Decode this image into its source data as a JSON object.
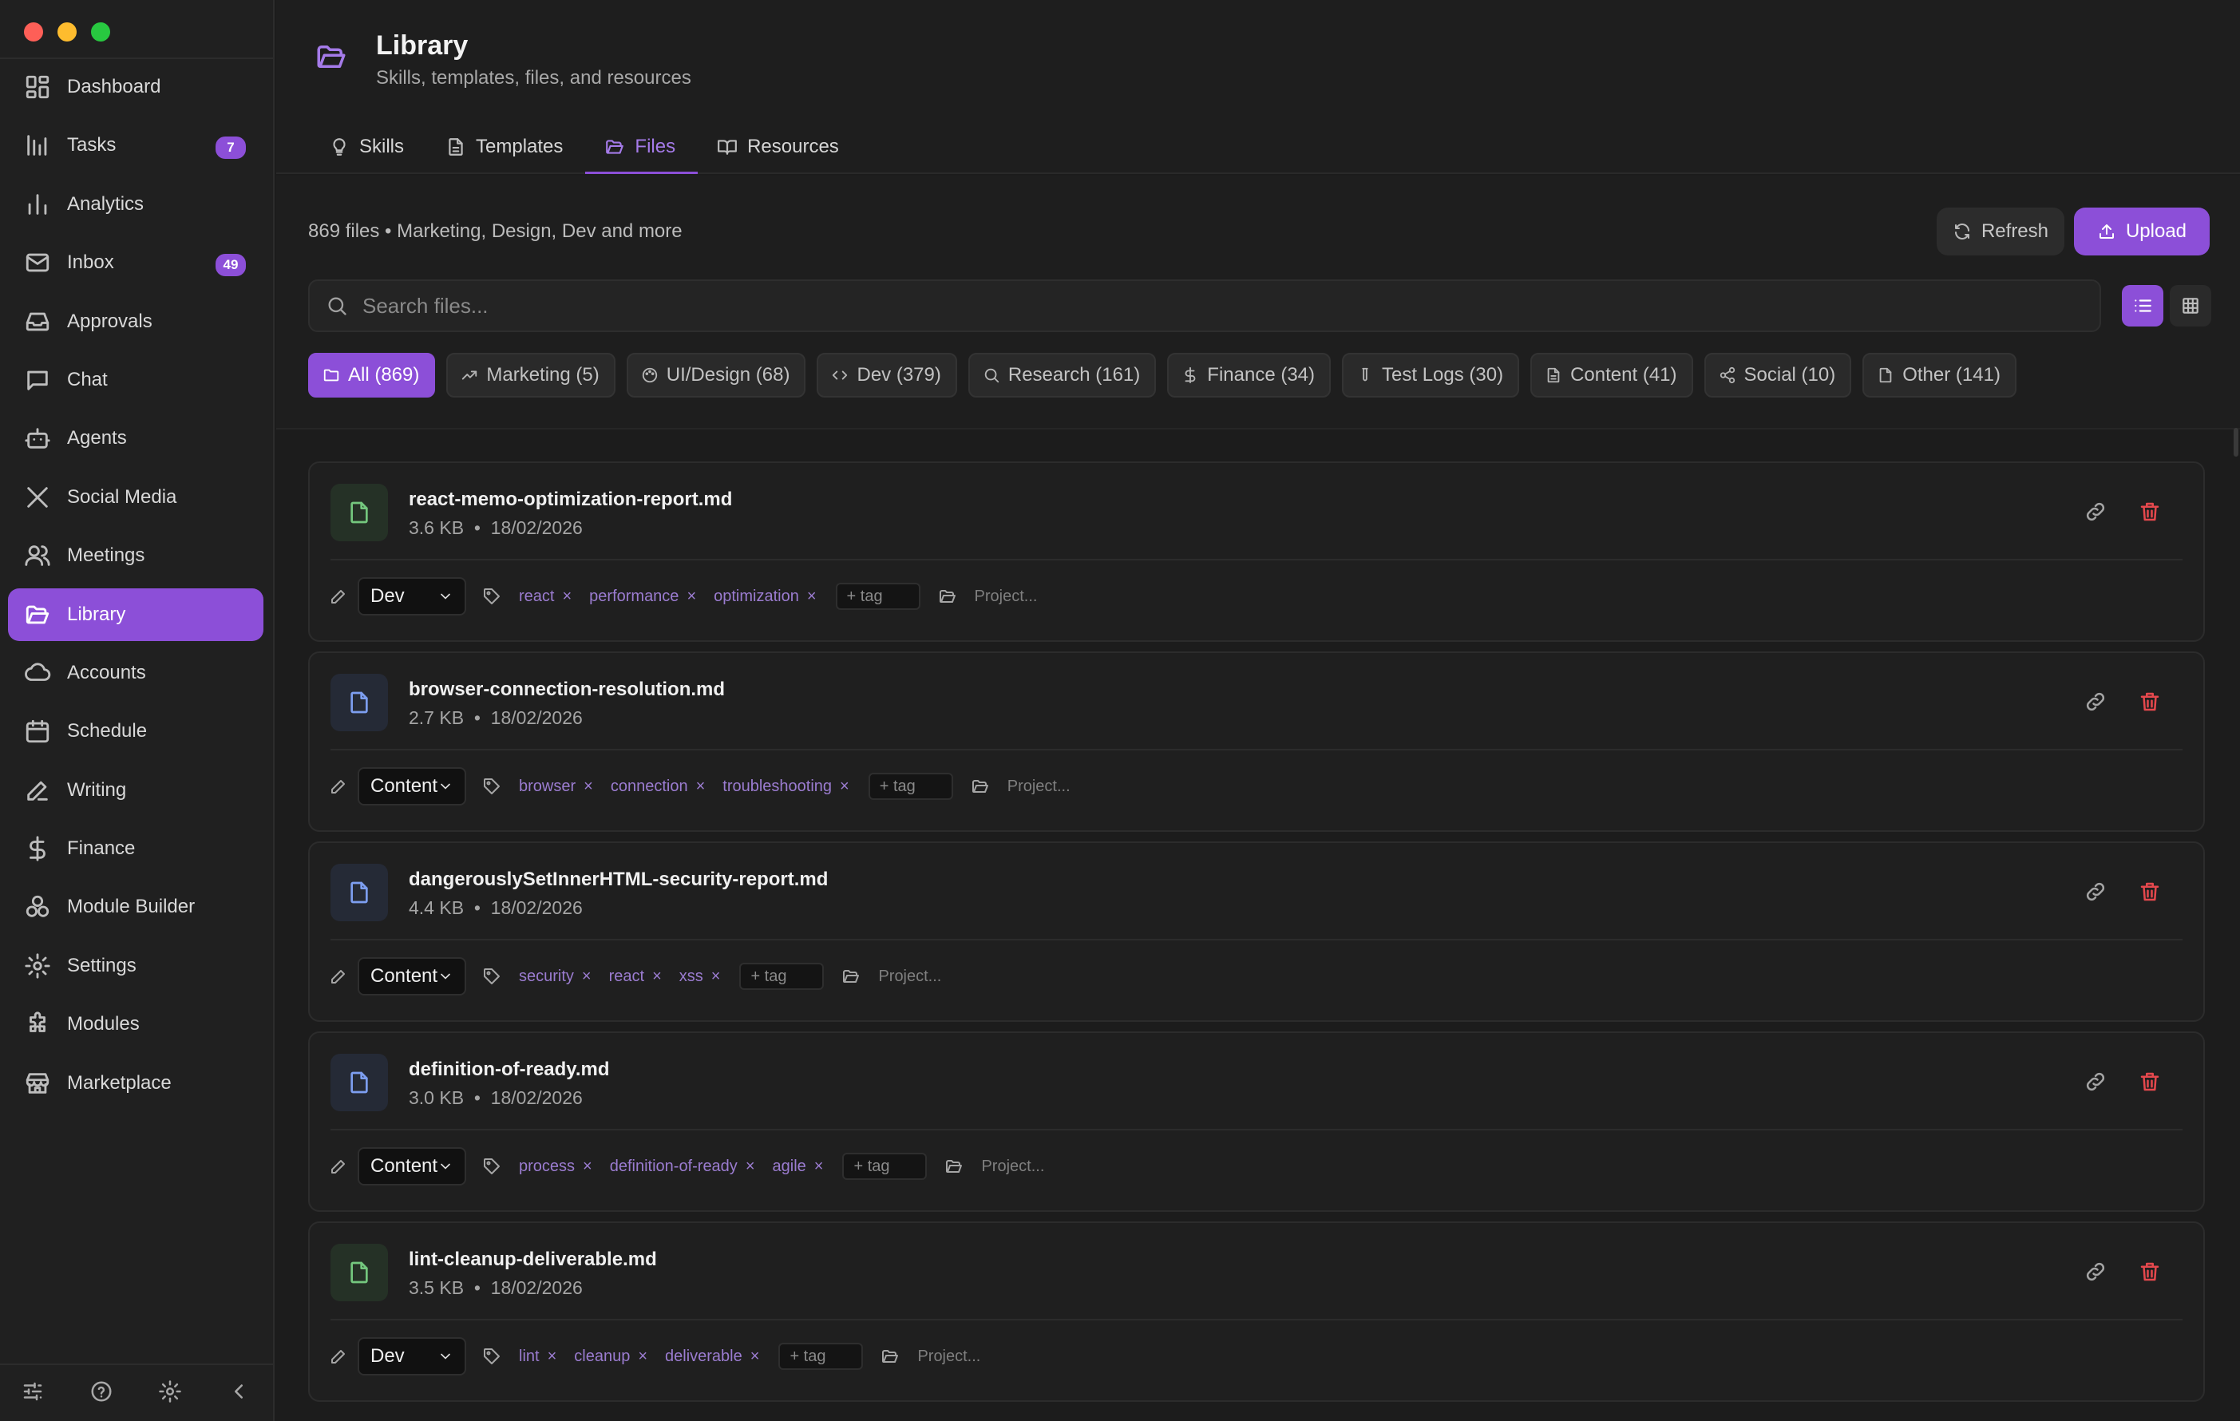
{
  "sidebar": {
    "items": [
      {
        "label": "Dashboard",
        "icon": "dashboard-icon",
        "badge": ""
      },
      {
        "label": "Tasks",
        "icon": "tasks-icon",
        "badge": "7"
      },
      {
        "label": "Analytics",
        "icon": "analytics-icon",
        "badge": ""
      },
      {
        "label": "Inbox",
        "icon": "inbox-icon",
        "badge": "49"
      },
      {
        "label": "Approvals",
        "icon": "approvals-icon",
        "badge": ""
      },
      {
        "label": "Chat",
        "icon": "chat-icon",
        "badge": ""
      },
      {
        "label": "Agents",
        "icon": "agents-icon",
        "badge": ""
      },
      {
        "label": "Social Media",
        "icon": "x-icon",
        "badge": ""
      },
      {
        "label": "Meetings",
        "icon": "meetings-icon",
        "badge": ""
      },
      {
        "label": "Library",
        "icon": "folder-open-icon",
        "badge": "",
        "active": true
      },
      {
        "label": "Accounts",
        "icon": "cloud-icon",
        "badge": ""
      },
      {
        "label": "Schedule",
        "icon": "calendar-icon",
        "badge": ""
      },
      {
        "label": "Writing",
        "icon": "pen-icon",
        "badge": ""
      },
      {
        "label": "Finance",
        "icon": "dollar-icon",
        "badge": ""
      },
      {
        "label": "Module Builder",
        "icon": "module-builder-icon",
        "badge": ""
      },
      {
        "label": "Settings",
        "icon": "settings-icon",
        "badge": ""
      },
      {
        "label": "Modules",
        "icon": "puzzle-icon",
        "badge": ""
      },
      {
        "label": "Marketplace",
        "icon": "store-icon",
        "badge": ""
      }
    ]
  },
  "header": {
    "title": "Library",
    "subtitle": "Skills, templates, files, and resources",
    "tabs": [
      {
        "label": "Skills",
        "icon": "lightbulb-icon"
      },
      {
        "label": "Templates",
        "icon": "document-icon"
      },
      {
        "label": "Files",
        "icon": "folder-open-icon",
        "active": true
      },
      {
        "label": "Resources",
        "icon": "book-icon"
      }
    ]
  },
  "toolbar": {
    "count_text": "869 files • Marketing, Design, Dev and more",
    "refresh_label": "Refresh",
    "upload_label": "Upload",
    "search_placeholder": "Search files..."
  },
  "filters": [
    {
      "label": "All (869)",
      "icon": "folder-icon",
      "active": true
    },
    {
      "label": "Marketing (5)",
      "icon": "trending-up-icon"
    },
    {
      "label": "UI/Design (68)",
      "icon": "palette-icon"
    },
    {
      "label": "Dev (379)",
      "icon": "code-icon"
    },
    {
      "label": "Research (161)",
      "icon": "search-icon"
    },
    {
      "label": "Finance (34)",
      "icon": "dollar-icon"
    },
    {
      "label": "Test Logs (30)",
      "icon": "test-tube-icon"
    },
    {
      "label": "Content (41)",
      "icon": "document-icon"
    },
    {
      "label": "Social (10)",
      "icon": "share-icon"
    },
    {
      "label": "Other (141)",
      "icon": "file-icon"
    }
  ],
  "files": [
    {
      "name": "react-memo-optimization-report.md",
      "size": "3.6 KB",
      "date": "18/02/2026",
      "category": "Dev",
      "tags": [
        "react",
        "performance",
        "optimization"
      ],
      "add_tag": "+ tag",
      "project_placeholder": "Project...",
      "icon_color": "green"
    },
    {
      "name": "browser-connection-resolution.md",
      "size": "2.7 KB",
      "date": "18/02/2026",
      "category": "Content",
      "tags": [
        "browser",
        "connection",
        "troubleshooting"
      ],
      "add_tag": "+ tag",
      "project_placeholder": "Project...",
      "icon_color": "blue"
    },
    {
      "name": "dangerouslySetInnerHTML-security-report.md",
      "size": "4.4 KB",
      "date": "18/02/2026",
      "category": "Content",
      "tags": [
        "security",
        "react",
        "xss"
      ],
      "add_tag": "+ tag",
      "project_placeholder": "Project...",
      "icon_color": "blue"
    },
    {
      "name": "definition-of-ready.md",
      "size": "3.0 KB",
      "date": "18/02/2026",
      "category": "Content",
      "tags": [
        "process",
        "definition-of-ready",
        "agile"
      ],
      "add_tag": "+ tag",
      "project_placeholder": "Project...",
      "icon_color": "blue"
    },
    {
      "name": "lint-cleanup-deliverable.md",
      "size": "3.5 KB",
      "date": "18/02/2026",
      "category": "Dev",
      "tags": [
        "lint",
        "cleanup",
        "deliverable"
      ],
      "add_tag": "+ tag",
      "project_placeholder": "Project...",
      "icon_color": "green"
    }
  ],
  "colors": {
    "accent": "#8c4fd8",
    "danger": "#e5484d",
    "tag": "#9b7cd0"
  }
}
